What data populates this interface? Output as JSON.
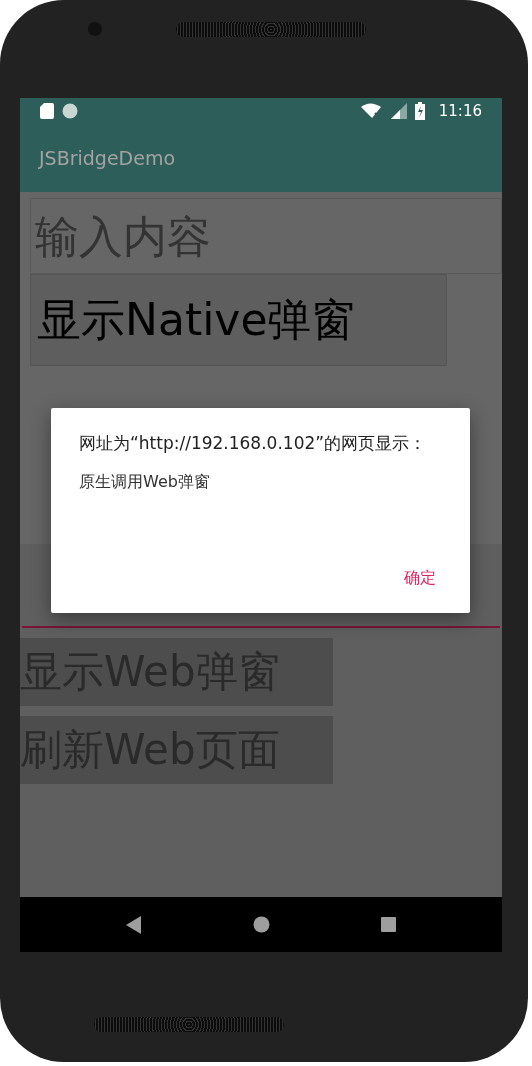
{
  "status_bar": {
    "time": "11:16"
  },
  "app_bar": {
    "title": "JSBridgeDemo"
  },
  "native": {
    "input": {
      "placeholder": "输入内容"
    },
    "button": "显示Native弹窗"
  },
  "web": {
    "buttons": [
      "显示Web弹窗",
      "刷新Web页面"
    ]
  },
  "dialog": {
    "title": "网址为“http://192.168.0.102”的网页显示：",
    "message": "原生调用Web弹窗",
    "buttons": [
      "确定"
    ]
  }
}
